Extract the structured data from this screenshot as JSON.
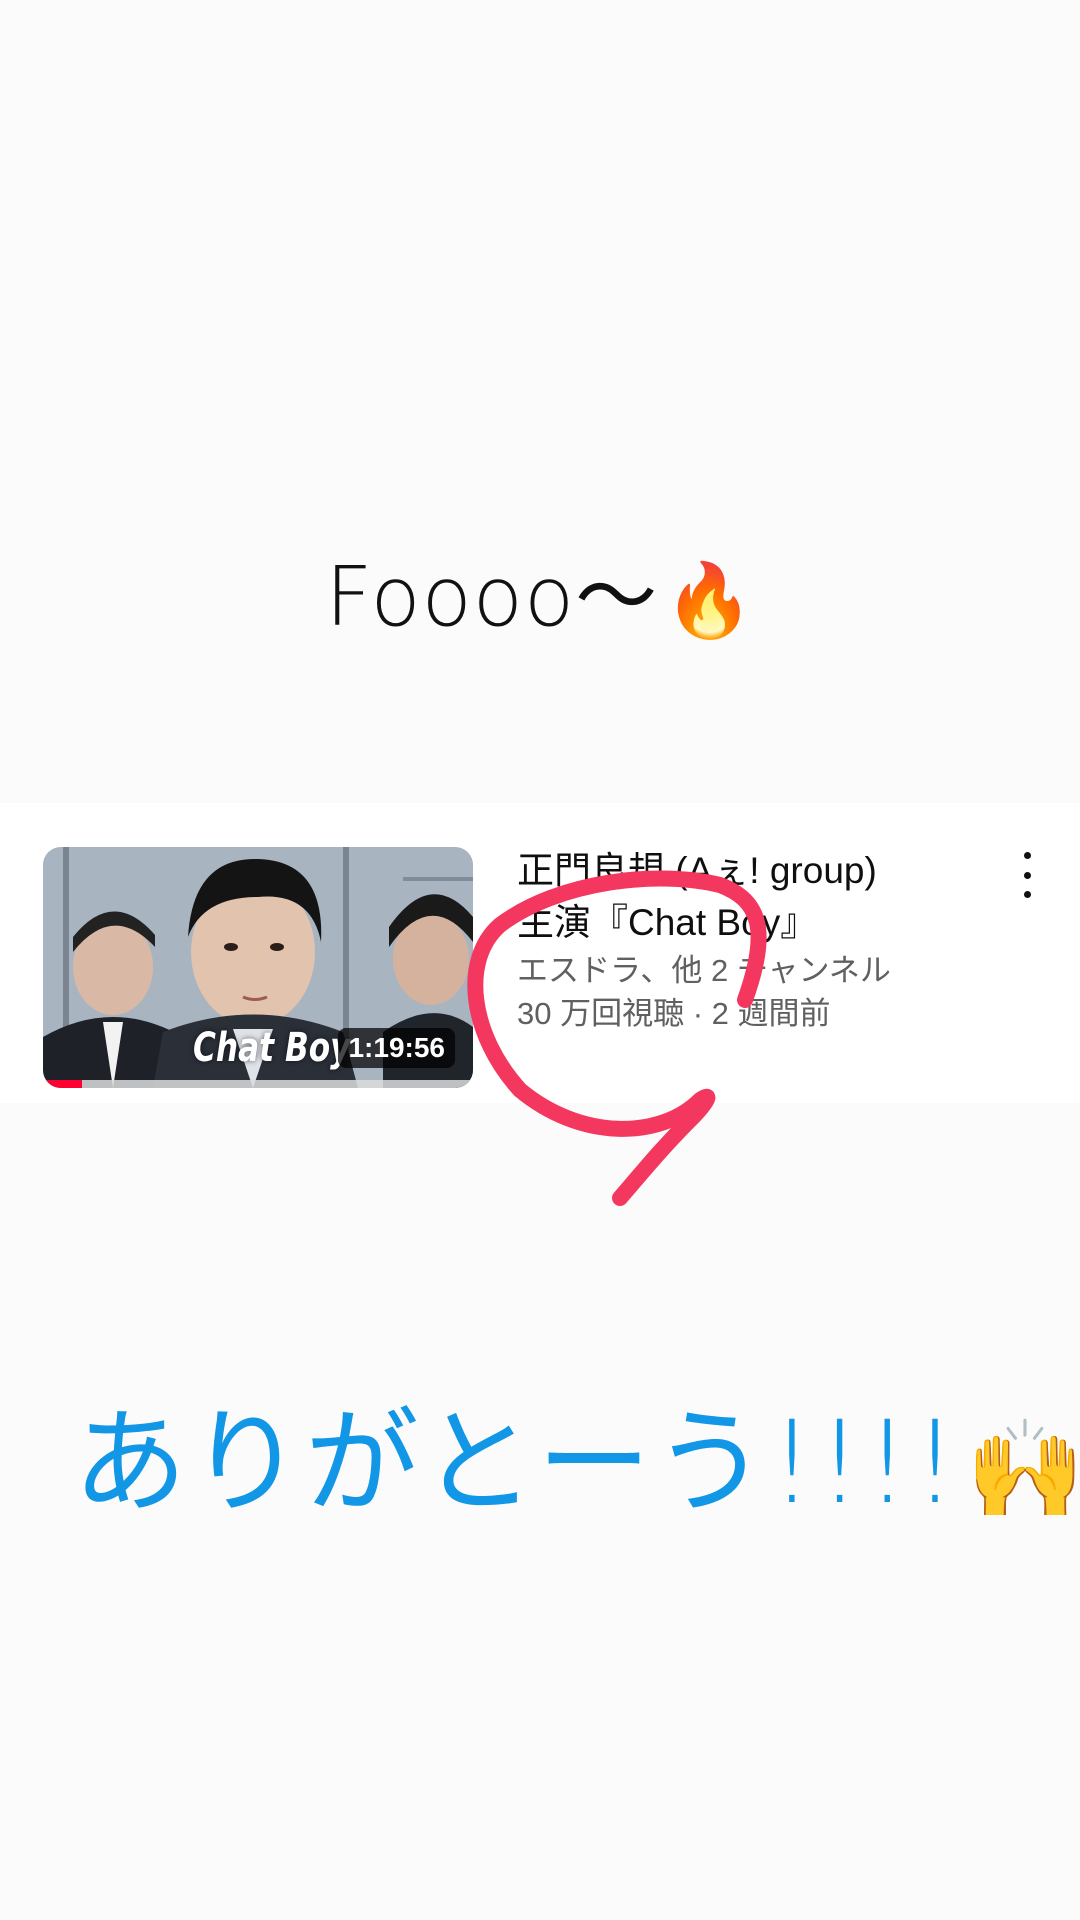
{
  "story": {
    "top_caption": "Foooo〜",
    "top_emoji": "🔥",
    "bottom_caption": "ありがとーう!!!!",
    "bottom_emoji": "🙌"
  },
  "video": {
    "thumbnail_logo": "Chat Boy",
    "duration": "1:19:56",
    "watch_progress": 0.09,
    "title_line1": "正門良規 (Aぇ! group)",
    "title_line2": "主演『Chat Boy』",
    "channel": "エスドラ、他 2 チャンネル",
    "stats": "30 万回視聴 · 2 週間前",
    "menu_icon": "more-vert-icon"
  },
  "colors": {
    "caption_blue": "#1296e6",
    "scribble_pink": "#f4375e",
    "progress_red": "#ff0033"
  }
}
